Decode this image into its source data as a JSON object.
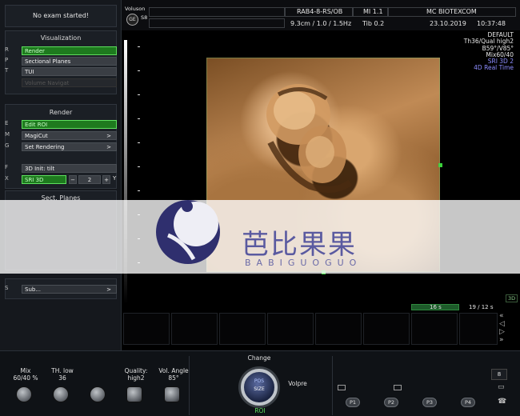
{
  "left_panel": {
    "status": "No exam started!",
    "visualization": {
      "title": "Visualization",
      "items": [
        {
          "key": "R",
          "label": "Render",
          "state": "active"
        },
        {
          "key": "P",
          "label": "Sectional Planes",
          "state": "normal"
        },
        {
          "key": "T",
          "label": "TUI",
          "state": "normal"
        },
        {
          "key": "",
          "label": "Volume Navigat",
          "state": "disabled"
        }
      ]
    },
    "render": {
      "title": "Render",
      "items": [
        {
          "key": "E",
          "label": "Edit ROI",
          "state": "active",
          "arrow": ""
        },
        {
          "key": "M",
          "label": "MagiCut",
          "state": "normal",
          "arrow": ">"
        },
        {
          "key": "G",
          "label": "Set Rendering",
          "state": "normal",
          "arrow": ">"
        }
      ]
    },
    "init": {
      "key": "F",
      "label": "3D Init: tilt"
    },
    "sri": {
      "key": "X",
      "label": "SRI 3D",
      "minus": "−",
      "value": "2",
      "plus": "+",
      "suffix": "Y"
    },
    "sect_planes": {
      "title": "Sect. Planes"
    },
    "sub": {
      "key": "S",
      "label": "Sub...",
      "arrow": ">"
    }
  },
  "header": {
    "brand": "Voluson",
    "brand_sub": "S8",
    "logo": "GE",
    "probe": "RAB4-8-RS/OB",
    "mi": "MI  1.1",
    "site": "MC BIOTEXCOM",
    "depth": "9.3cm / 1.0 / 1.5Hz",
    "tib": "Tib  0.2",
    "date": "23.10.2019",
    "time": "10:37:48"
  },
  "info": {
    "lines": [
      "DEFAULT",
      "Th36/Qual high2",
      "B59°/V85°",
      "Mix60/40"
    ],
    "blue_lines": [
      "SRI 3D 2",
      "4D Real Time"
    ]
  },
  "watermark": {
    "text": "芭比果果",
    "sub": "BABIGUOGUO"
  },
  "timeline": {
    "left": "16 s",
    "right": "19 / 12 s",
    "tag": "3D"
  },
  "controls": {
    "mix": "Mix\n60/40 %",
    "th_low": "TH. low\n36",
    "quality": "Quality:\nhigh2",
    "vol_angle": "Vol. Angle\n85°",
    "change": "Change",
    "roi": "ROI",
    "center_top": "POS",
    "center_bottom": "SIZE",
    "volpre": "Volpre",
    "p_buttons": [
      "P1",
      "P2",
      "P3",
      "P4"
    ],
    "side_digit": "8"
  },
  "colors": {
    "accent_green": "#5ee05e",
    "info_blue": "#8d8dff",
    "watermark": "#5a5aa0"
  }
}
